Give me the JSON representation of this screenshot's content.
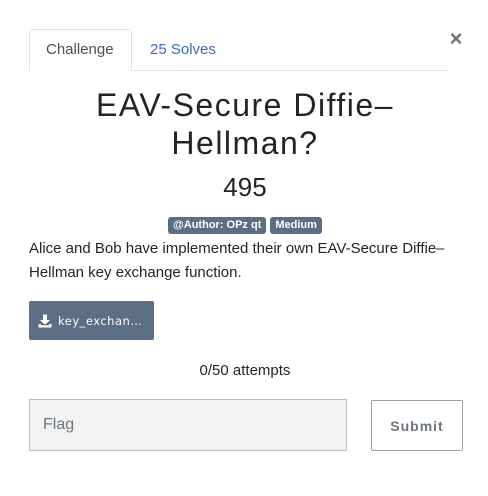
{
  "close_symbol": "×",
  "tabs": [
    {
      "label": "Challenge",
      "active": true
    },
    {
      "label": "25 Solves",
      "active": false
    }
  ],
  "challenge": {
    "title": "EAV-Secure Diffie–Hellman?",
    "points": "495",
    "tags": [
      "@Author: OPz qt",
      "Medium"
    ],
    "description": "Alice and Bob have implemented their own EAV-Secure Diffie–Hellman key exchange function."
  },
  "file": {
    "label": "key_exchang...",
    "icon": "download-icon"
  },
  "attempts": "0/50 attempts",
  "flag_input": {
    "placeholder": "Flag",
    "value": ""
  },
  "submit_label": "Submit",
  "colors": {
    "link": "#3b6cb5",
    "badge_bg": "#5c6e83",
    "file_btn_bg": "#5c6e83",
    "input_bg": "#f2f2f2"
  }
}
